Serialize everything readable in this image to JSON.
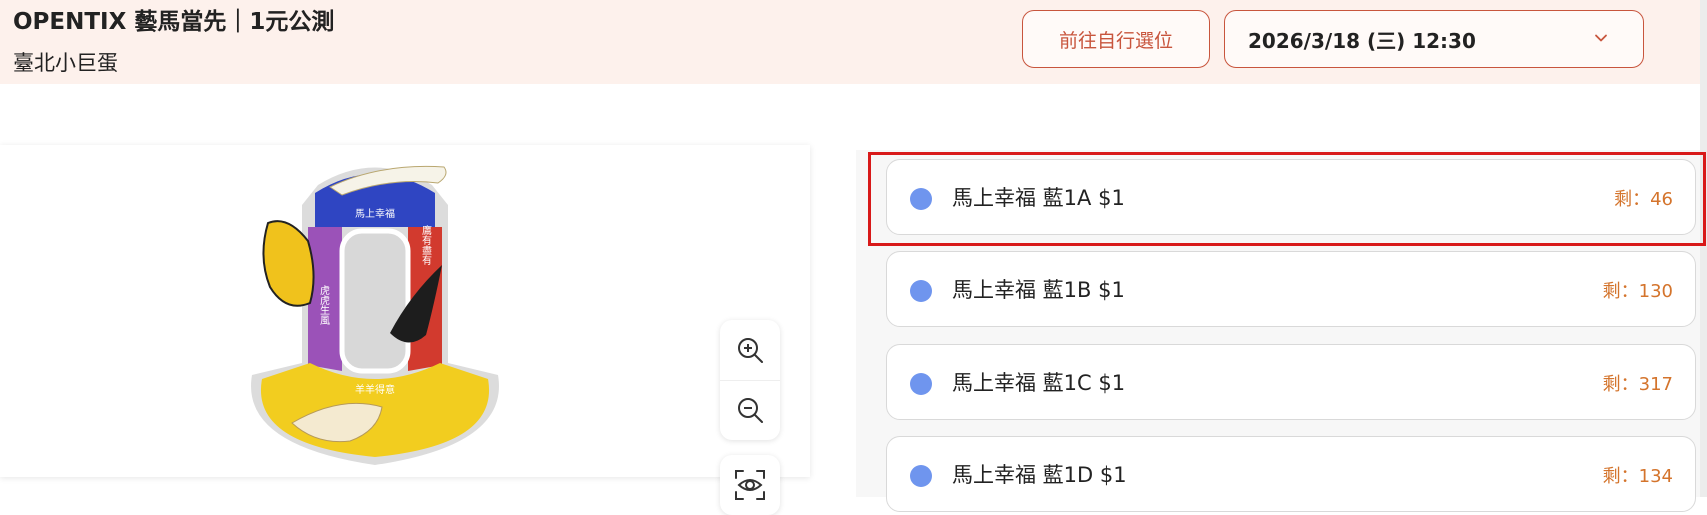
{
  "header": {
    "title": "OPENTIX 藝馬當先｜1元公測",
    "venue": "臺北小巨蛋",
    "self_select_label": "前往自行選位",
    "session_date": "2026/3/18 (三) 12:30"
  },
  "seat_map": {
    "section_labels": {
      "top": "馬上幸福",
      "right": "鷹有盡有",
      "left": "虎虎生風",
      "bottom": "羊羊得意"
    },
    "controls": {
      "zoom_in": "zoom-in-icon",
      "zoom_out": "zoom-out-icon",
      "view": "eye-scan-icon"
    }
  },
  "ticket_list": [
    {
      "label": "馬上幸福 藍1A $1",
      "remain": "剩：46",
      "selected": true
    },
    {
      "label": "馬上幸福 藍1B $1",
      "remain": "剩：130",
      "selected": false
    },
    {
      "label": "馬上幸福 藍1C $1",
      "remain": "剩：317",
      "selected": false
    },
    {
      "label": "馬上幸福 藍1D $1",
      "remain": "剩：134",
      "selected": false
    }
  ],
  "colors": {
    "accent": "#c8553d",
    "dot_blue": "#6f95ee",
    "remain_orange": "#d4742c",
    "highlight_red": "#d81919",
    "header_bg": "#fdf1ec"
  }
}
